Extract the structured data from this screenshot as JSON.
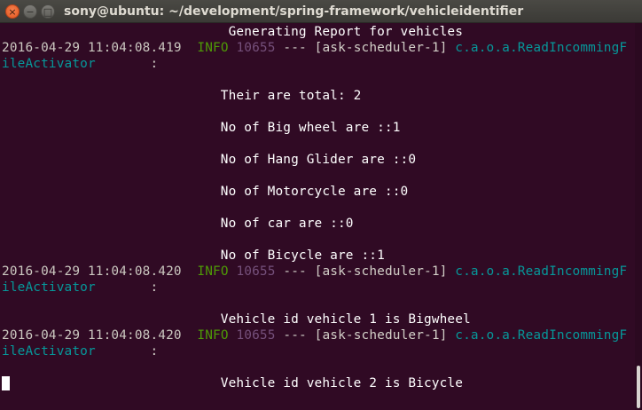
{
  "window": {
    "title": "sony@ubuntu: ~/development/spring-framework/vehicleidentifier",
    "close_glyph": "×",
    "minimize_glyph": "−",
    "maximize_glyph": "□"
  },
  "colors": {
    "background": "#300a24",
    "info": "#4e9a06",
    "pid": "#75507b",
    "logger": "#06989a",
    "text": "#ffffff"
  },
  "terminal": {
    "header": "                             Generating Report for vehicles",
    "logs": [
      {
        "timestamp": "2016-04-29 11:04:08.419",
        "level": "INFO",
        "pid": "10655",
        "separator": "--- [ask-scheduler-1]",
        "logger_start": "c.a.o.a.ReadIncommingF",
        "logger_end": "ileActivator",
        "colon": "       :"
      },
      {
        "timestamp": "2016-04-29 11:04:08.420",
        "level": "INFO",
        "pid": "10655",
        "separator": "--- [ask-scheduler-1]",
        "logger_start": "c.a.o.a.ReadIncommingF",
        "logger_end": "ileActivator",
        "colon": "       :"
      },
      {
        "timestamp": "2016-04-29 11:04:08.420",
        "level": "INFO",
        "pid": "10655",
        "separator": "--- [ask-scheduler-1]",
        "logger_start": "c.a.o.a.ReadIncommingF",
        "logger_end": "ileActivator",
        "colon": "       :"
      }
    ],
    "report": [
      "                            Their are total: 2",
      "                            No of Big wheel are ::1",
      "                            No of Hang Glider are ::0",
      "                            No of Motorcycle are ::0",
      "                            No of car are ::0",
      "                            No of Bicycle are ::1"
    ],
    "vehicle_lines": [
      "                            Vehicle id vehicle 1 is Bigwheel",
      "                            Vehicle id vehicle 2 is Bicycle"
    ]
  }
}
